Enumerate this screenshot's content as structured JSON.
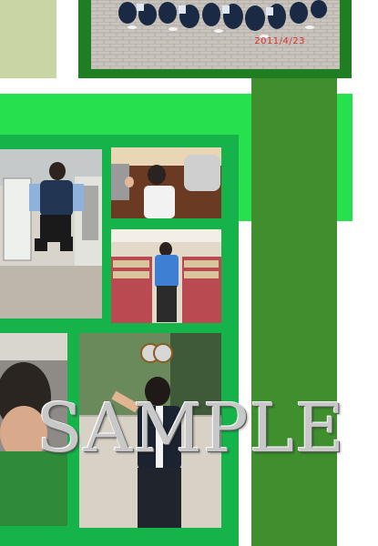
{
  "page": {
    "colors": {
      "pale_sage": "#c9d6a3",
      "bright_green": "#27e04d",
      "mid_green": "#16b34a",
      "dark_green": "#2a8a2a",
      "bar_green": "#3f8f2f"
    }
  },
  "photos": {
    "group_photo": {
      "date_stamp": "2011/4/23",
      "icon": "group-photo"
    },
    "jump_photo": {
      "icon": "student-jumping-photo"
    },
    "bus_photo": {
      "icon": "student-on-bus-photo"
    },
    "bookfair_photo": {
      "icon": "student-at-bookfair-photo"
    },
    "closeup_photo": {
      "icon": "student-closeup-photo"
    },
    "pose_photo": {
      "icon": "student-posing-photo"
    }
  },
  "watermark": {
    "text": "SAMPLE"
  }
}
